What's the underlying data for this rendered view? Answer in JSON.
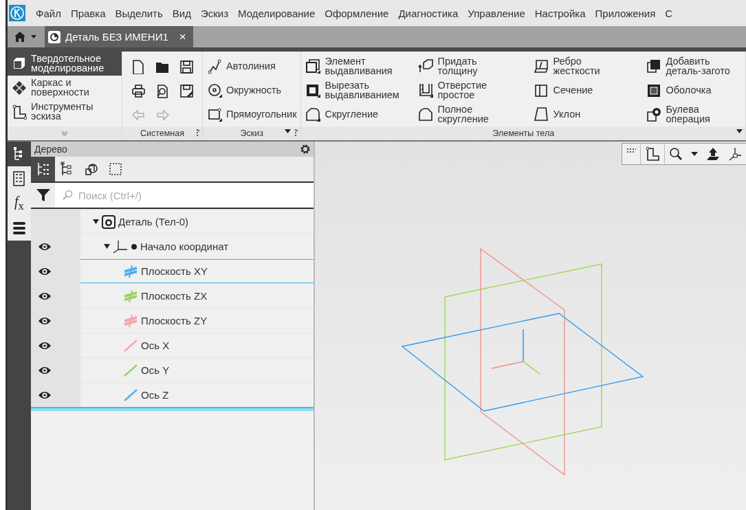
{
  "menu": [
    "Файл",
    "Правка",
    "Выделить",
    "Вид",
    "Эскиз",
    "Моделирование",
    "Оформление",
    "Диагностика",
    "Управление",
    "Настройка",
    "Приложения",
    "С"
  ],
  "document_tabs": [
    {
      "label": "Деталь БЕЗ ИМЕНИ1",
      "close": "×",
      "selected": true
    }
  ],
  "ribbon": {
    "modes": [
      {
        "label": "Твердотельное\nмоделирование",
        "selected": true
      },
      {
        "label": "Каркас и\nповерхности",
        "selected": false
      },
      {
        "label": "Инструменты\nэскиза",
        "selected": false
      }
    ],
    "groups": [
      {
        "kind": "tools",
        "label": "Системная",
        "tools": [
          {
            "disabled": false
          },
          {
            "disabled": false
          },
          {
            "disabled": false
          },
          {
            "disabled": false
          },
          {
            "disabled": false
          },
          {
            "disabled": false
          },
          {
            "disabled": true
          },
          {
            "disabled": true
          }
        ]
      },
      {
        "kind": "commands",
        "label": "Эскиз",
        "commands": [
          "Автолиния",
          "Окружность",
          "Прямоугольник"
        ]
      },
      {
        "kind": "commands",
        "label": "Элементы тела",
        "commands": [
          "Элемент\nвыдавливания",
          "Вырезать\nвыдавливанием",
          "Скругление",
          "Придать\nтолщину",
          "Отверстие\nпростое",
          "Полное\nскругление",
          "Ребро\nжесткости",
          "Сечение",
          "Уклон",
          "Добавить\nдеталь-загото",
          "Оболочка",
          "Булева\nоперация"
        ]
      }
    ]
  },
  "side_tabs": [
    {
      "selected": true
    },
    {
      "selected": false
    },
    {
      "selected": false,
      "glyph": "*f*$_{x}$"
    },
    {
      "selected": false
    }
  ],
  "tree_panel": {
    "title": "Дерево",
    "toolbar": [
      {
        "selected": true
      },
      {
        "selected": false
      },
      {
        "selected": false
      },
      {
        "selected": false
      }
    ],
    "search": {
      "placeholder": "Поиск (Ctrl+/)"
    },
    "tree": [
      {
        "kind": "part",
        "label": "Деталь (Тел-0)",
        "expanded": true,
        "selected": false,
        "children": [
          {
            "kind": "origin",
            "label": "Начало координат",
            "expanded": true,
            "selected": false,
            "visible": true,
            "children": [
              {
                "kind": "plane",
                "label": "Плоскость XY",
                "color": "#4fb0f0",
                "selected": true,
                "visible": true
              },
              {
                "kind": "plane",
                "label": "Плоскость ZX",
                "color": "#9ad266",
                "selected": false,
                "visible": true
              },
              {
                "kind": "plane",
                "label": "Плоскость ZY",
                "color": "#f5a3ab",
                "selected": false,
                "visible": true
              },
              {
                "kind": "axis",
                "label": "Ось X",
                "color": "#f5a3ab",
                "selected": false,
                "visible": true
              },
              {
                "kind": "axis",
                "label": "Ось Y",
                "color": "#9ad266",
                "selected": false,
                "visible": true
              },
              {
                "kind": "axis",
                "label": "Ось Z",
                "color": "#4fb0f0",
                "selected": false,
                "visible": true
              }
            ]
          }
        ]
      }
    ]
  }
}
